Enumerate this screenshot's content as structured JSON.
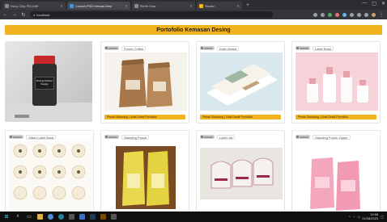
{
  "browser": {
    "tabs": [
      {
        "label": "Hony Clay PELDMI",
        "active": false
      },
      {
        "label": "Contoh PSD Kemas Desi",
        "active": true
      },
      {
        "label": "Rivhit Ckar",
        "active": false
      },
      {
        "label": "Sbulen",
        "active": false
      }
    ],
    "new_tab": "+",
    "window_controls": [
      "—",
      "▢",
      "✕"
    ],
    "nav": {
      "back": "←",
      "forward": "→",
      "reload": "↻"
    },
    "address": "localhost"
  },
  "page": {
    "title": "Portofolio Kemasan Desing",
    "featured": {
      "label": "Desing Kitchen Supply",
      "brand": "Neshop"
    },
    "cards": [
      {
        "label": "Pouch Coffee",
        "footer": "Pesan Sekarang  |  Lihat Detail Portofolio",
        "kind": "pouch"
      },
      {
        "label": "Kartu Nama",
        "footer": "Pesan Sekarang  |  Lihat Detail Portofolio",
        "kind": "cards"
      },
      {
        "label": "Label Botol",
        "footer": "Pesan Sekarang  |  Lihat Detail Portofolio",
        "kind": "bottles"
      },
      {
        "label": "Stiker Label Bulat",
        "footer": "",
        "kind": "stickers"
      },
      {
        "label": "Standing Pouch",
        "footer": "",
        "kind": "yellow"
      },
      {
        "label": "Label Jar",
        "footer": "",
        "kind": "jars"
      },
      {
        "label": "Standing Pouch Zipper",
        "footer": "",
        "kind": "pink"
      }
    ]
  },
  "taskbar": {
    "time": "13:08",
    "date": "21/08/2023"
  },
  "colors": {
    "accent": "#f2b320",
    "chrome_dark": "#2b2d31",
    "taskbar": "#101010"
  }
}
